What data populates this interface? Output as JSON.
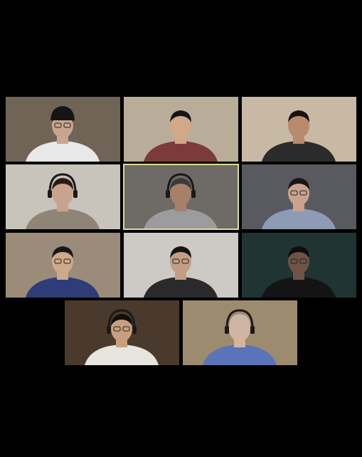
{
  "app": {
    "view": "gallery",
    "background_color": "#000000",
    "active_speaker_border_color": "#d9e08a"
  },
  "participants": [
    {
      "id": 1,
      "bg": "#6f6456",
      "shirt": "#e9e9e9",
      "skin": "#caa48e",
      "hair": "#1b1b1b",
      "has_beanie": true,
      "has_glasses": true,
      "has_headphones": false
    },
    {
      "id": 2,
      "bg": "#b9ad9a",
      "shirt": "#7c3b3b",
      "skin": "#d1a888",
      "hair": "#141414",
      "has_beanie": false,
      "has_glasses": false,
      "has_headphones": false
    },
    {
      "id": 3,
      "bg": "#c7b9a3",
      "shirt": "#2b2b2b",
      "skin": "#b98a6b",
      "hair": "#161210",
      "has_beanie": false,
      "has_glasses": false,
      "has_headphones": false
    },
    {
      "id": 4,
      "bg": "#c9c4bb",
      "shirt": "#8f8576",
      "skin": "#c9a38f",
      "hair": "#2a1c14",
      "has_beanie": false,
      "has_glasses": false,
      "has_headphones": true
    },
    {
      "id": 5,
      "bg": "#6e6a66",
      "shirt": "#9c9c9e",
      "skin": "#a7806a",
      "hair": "#3a3a3a",
      "has_beanie": false,
      "has_glasses": false,
      "has_headphones": true,
      "active": true
    },
    {
      "id": 6,
      "bg": "#585a60",
      "shirt": "#8e9bb4",
      "skin": "#caa38c",
      "hair": "#171717",
      "has_beanie": false,
      "has_glasses": true,
      "has_headphones": false
    },
    {
      "id": 7,
      "bg": "#9a8c78",
      "shirt": "#2e3c78",
      "skin": "#cfa98b",
      "hair": "#181818",
      "has_beanie": false,
      "has_glasses": true,
      "has_headphones": false
    },
    {
      "id": 8,
      "bg": "#cdcac6",
      "shirt": "#2a2a2a",
      "skin": "#c39e84",
      "hair": "#141414",
      "has_beanie": false,
      "has_glasses": true,
      "has_headphones": false
    },
    {
      "id": 9,
      "bg": "#1f3433",
      "shirt": "#141414",
      "skin": "#6d5446",
      "hair": "#0d0d0d",
      "has_beanie": false,
      "has_glasses": true,
      "has_headphones": false
    },
    {
      "id": 10,
      "bg": "#4a3a2d",
      "shirt": "#e7e5df",
      "skin": "#c9a07f",
      "hair": "#120f0d",
      "has_beanie": false,
      "has_glasses": true,
      "has_headphones": true
    },
    {
      "id": 11,
      "bg": "#9c8b6f",
      "shirt": "#5a74b8",
      "skin": "#d2b4a2",
      "hair": "#c9b7a6",
      "has_beanie": false,
      "has_glasses": false,
      "has_headphones": true
    }
  ]
}
